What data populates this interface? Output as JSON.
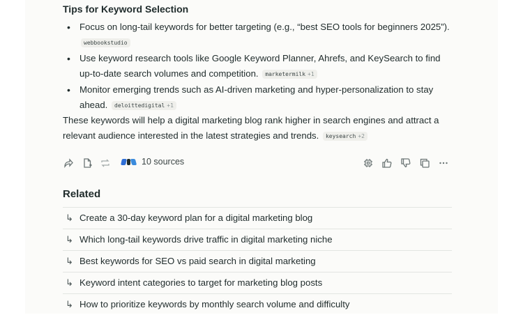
{
  "answer": {
    "section_title": "Tips for Keyword Selection",
    "bullets": [
      {
        "text": "Focus on long-tail keywords for better targeting (e.g., “best SEO tools for beginners 2025”).",
        "source": "webbookstudio",
        "extra": ""
      },
      {
        "text": "Use keyword research tools like Google Keyword Planner, Ahrefs, and KeySearch to find up-to-date search volumes and competition.",
        "source": "marketermilk",
        "extra": "+1"
      },
      {
        "text": "Monitor emerging trends such as AI-driven marketing and hyper-personalization to stay ahead.",
        "source": "deloittedigital",
        "extra": "+1"
      }
    ],
    "summary": {
      "text": "These keywords will help a digital marketing blog rank higher in search engines and attract a relevant audience interested in the latest strategies and trends.",
      "source": "keysearch",
      "extra": "+2"
    }
  },
  "toolbar": {
    "sources_label": "10 sources",
    "source_colors": [
      "#2f6fd6",
      "#1f2b2b",
      "#3b8bdc"
    ],
    "icons": [
      "share-icon",
      "export-icon",
      "rewrite-icon",
      "chip-icon",
      "thumbs-up-icon",
      "thumbs-down-icon",
      "copy-icon",
      "more-icon"
    ]
  },
  "related": {
    "title": "Related",
    "items": [
      "Create a 30-day keyword plan for a digital marketing blog",
      "Which long-tail keywords drive traffic in digital marketing niche",
      "Best keywords for SEO vs paid search in digital marketing",
      "Keyword intent categories to target for marketing blog posts",
      "How to prioritize keywords by monthly search volume and difficulty"
    ],
    "arrow_glyph": "↳"
  }
}
